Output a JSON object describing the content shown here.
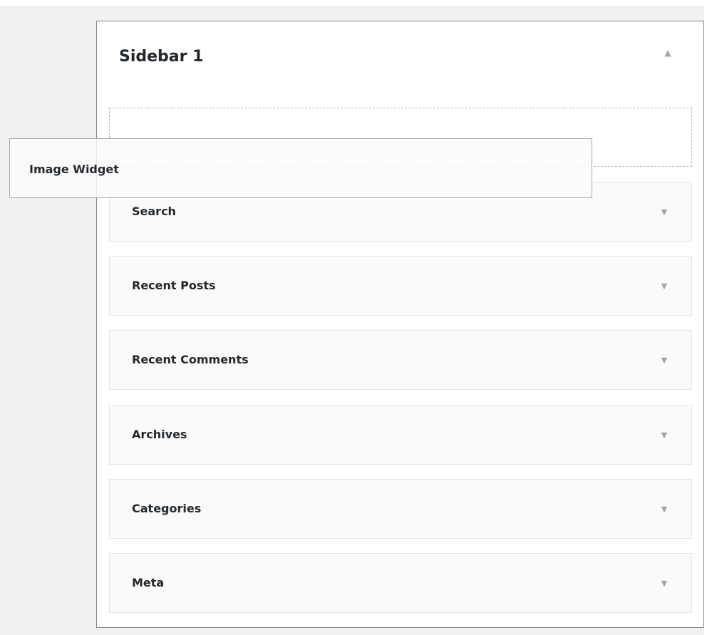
{
  "sidebar": {
    "title": "Sidebar 1",
    "toggle_icon": "triangle-up-icon",
    "widgets": [
      {
        "title": "Search",
        "icon": "triangle-down-icon"
      },
      {
        "title": "Recent Posts",
        "icon": "triangle-down-icon"
      },
      {
        "title": "Recent Comments",
        "icon": "triangle-down-icon"
      },
      {
        "title": "Archives",
        "icon": "triangle-down-icon"
      },
      {
        "title": "Categories",
        "icon": "triangle-down-icon"
      },
      {
        "title": "Meta",
        "icon": "triangle-down-icon"
      }
    ]
  },
  "dragging_widget": {
    "title": "Image Widget"
  },
  "colors": {
    "background": "#f1f1f1",
    "panel_border": "#7e8993",
    "widget_bg": "#fafafa",
    "text": "#23282d",
    "arrow": "#a0a5aa"
  }
}
